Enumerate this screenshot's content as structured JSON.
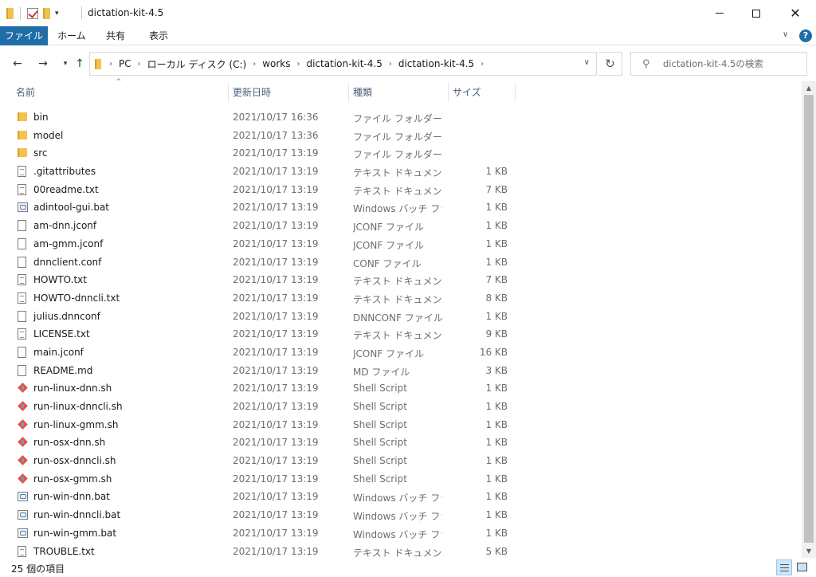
{
  "window": {
    "title": "dictation-kit-4.5",
    "controls": {
      "minimize": "—",
      "close": "✕"
    }
  },
  "ribbon": {
    "tabs": [
      {
        "label": "ファイル",
        "active": true
      },
      {
        "label": "ホーム"
      },
      {
        "label": "共有"
      },
      {
        "label": "表示"
      }
    ],
    "help": "?"
  },
  "nav": {
    "back": "←",
    "forward": "→",
    "recent": "▾",
    "up": "↑",
    "breadcrumbs": [
      "PC",
      "ローカル ディスク (C:)",
      "works",
      "dictation-kit-4.5",
      "dictation-kit-4.5"
    ],
    "refresh": "↻",
    "search_placeholder": "dictation-kit-4.5の検索"
  },
  "columns": {
    "name": "名前",
    "date": "更新日時",
    "type": "種類",
    "size": "サイズ"
  },
  "files": [
    {
      "name": "bin",
      "date": "2021/10/17 16:36",
      "type": "ファイル フォルダー",
      "size": "",
      "icon": "folder-icon"
    },
    {
      "name": "model",
      "date": "2021/10/17 13:36",
      "type": "ファイル フォルダー",
      "size": "",
      "icon": "folder-icon"
    },
    {
      "name": "src",
      "date": "2021/10/17 13:19",
      "type": "ファイル フォルダー",
      "size": "",
      "icon": "folder-icon"
    },
    {
      "name": ".gitattributes",
      "date": "2021/10/17 13:19",
      "type": "テキスト ドキュメント",
      "size": "1 KB",
      "icon": "text-document-icon"
    },
    {
      "name": "00readme.txt",
      "date": "2021/10/17 13:19",
      "type": "テキスト ドキュメント",
      "size": "7 KB",
      "icon": "text-document-icon"
    },
    {
      "name": "adintool-gui.bat",
      "date": "2021/10/17 13:19",
      "type": "Windows バッチ ファ...",
      "size": "1 KB",
      "icon": "batch-file-icon"
    },
    {
      "name": "am-dnn.jconf",
      "date": "2021/10/17 13:19",
      "type": "JCONF ファイル",
      "size": "1 KB",
      "icon": "blank-file-icon"
    },
    {
      "name": "am-gmm.jconf",
      "date": "2021/10/17 13:19",
      "type": "JCONF ファイル",
      "size": "1 KB",
      "icon": "blank-file-icon"
    },
    {
      "name": "dnnclient.conf",
      "date": "2021/10/17 13:19",
      "type": "CONF ファイル",
      "size": "1 KB",
      "icon": "blank-file-icon"
    },
    {
      "name": "HOWTO.txt",
      "date": "2021/10/17 13:19",
      "type": "テキスト ドキュメント",
      "size": "7 KB",
      "icon": "text-document-icon"
    },
    {
      "name": "HOWTO-dnncli.txt",
      "date": "2021/10/17 13:19",
      "type": "テキスト ドキュメント",
      "size": "8 KB",
      "icon": "text-document-icon"
    },
    {
      "name": "julius.dnnconf",
      "date": "2021/10/17 13:19",
      "type": "DNNCONF ファイル",
      "size": "1 KB",
      "icon": "blank-file-icon"
    },
    {
      "name": "LICENSE.txt",
      "date": "2021/10/17 13:19",
      "type": "テキスト ドキュメント",
      "size": "9 KB",
      "icon": "text-document-icon"
    },
    {
      "name": "main.jconf",
      "date": "2021/10/17 13:19",
      "type": "JCONF ファイル",
      "size": "16 KB",
      "icon": "blank-file-icon"
    },
    {
      "name": "README.md",
      "date": "2021/10/17 13:19",
      "type": "MD ファイル",
      "size": "3 KB",
      "icon": "blank-file-icon"
    },
    {
      "name": "run-linux-dnn.sh",
      "date": "2021/10/17 13:19",
      "type": "Shell Script",
      "size": "1 KB",
      "icon": "shell-script-icon"
    },
    {
      "name": "run-linux-dnncli.sh",
      "date": "2021/10/17 13:19",
      "type": "Shell Script",
      "size": "1 KB",
      "icon": "shell-script-icon"
    },
    {
      "name": "run-linux-gmm.sh",
      "date": "2021/10/17 13:19",
      "type": "Shell Script",
      "size": "1 KB",
      "icon": "shell-script-icon"
    },
    {
      "name": "run-osx-dnn.sh",
      "date": "2021/10/17 13:19",
      "type": "Shell Script",
      "size": "1 KB",
      "icon": "shell-script-icon"
    },
    {
      "name": "run-osx-dnncli.sh",
      "date": "2021/10/17 13:19",
      "type": "Shell Script",
      "size": "1 KB",
      "icon": "shell-script-icon"
    },
    {
      "name": "run-osx-gmm.sh",
      "date": "2021/10/17 13:19",
      "type": "Shell Script",
      "size": "1 KB",
      "icon": "shell-script-icon"
    },
    {
      "name": "run-win-dnn.bat",
      "date": "2021/10/17 13:19",
      "type": "Windows バッチ ファ...",
      "size": "1 KB",
      "icon": "batch-file-icon"
    },
    {
      "name": "run-win-dnncli.bat",
      "date": "2021/10/17 13:19",
      "type": "Windows バッチ ファ...",
      "size": "1 KB",
      "icon": "batch-file-icon"
    },
    {
      "name": "run-win-gmm.bat",
      "date": "2021/10/17 13:19",
      "type": "Windows バッチ ファ...",
      "size": "1 KB",
      "icon": "batch-file-icon"
    },
    {
      "name": "TROUBLE.txt",
      "date": "2021/10/17 13:19",
      "type": "テキスト ドキュメント",
      "size": "5 KB",
      "icon": "text-document-icon"
    }
  ],
  "status": {
    "item_count": "25 個の項目"
  },
  "colors": {
    "accent": "#1f6ea8",
    "header_text": "#4c607a",
    "secondary_text": "#6d6d6d",
    "folder": "#f2c14e"
  }
}
